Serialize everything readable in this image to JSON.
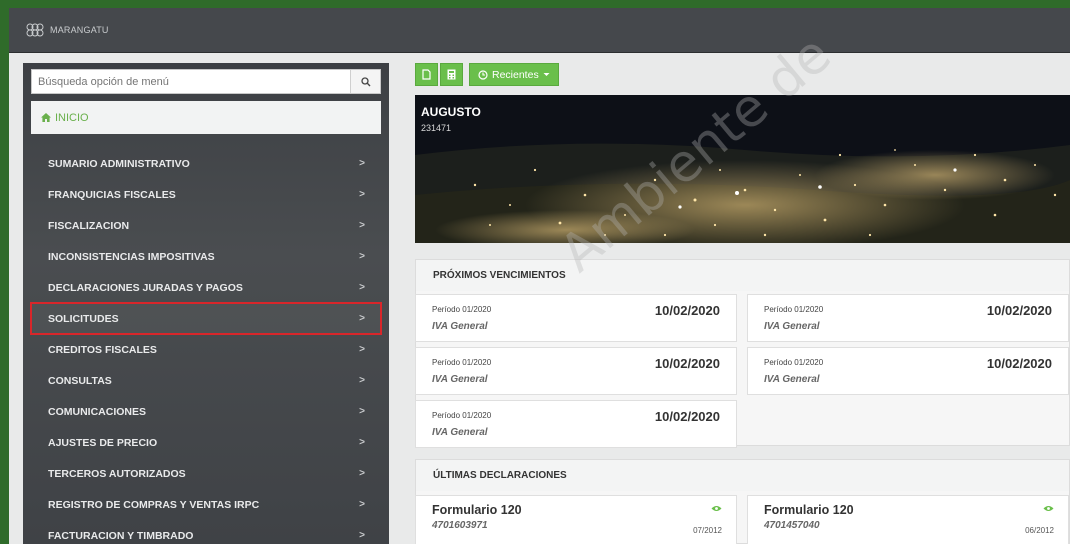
{
  "app": {
    "brand": "MARANGATU"
  },
  "sidebar": {
    "search_placeholder": "Búsqueda opción de menú",
    "inicio": "INICIO",
    "items": [
      {
        "label": "SUMARIO ADMINISTRATIVO"
      },
      {
        "label": "FRANQUICIAS FISCALES"
      },
      {
        "label": "FISCALIZACION"
      },
      {
        "label": "INCONSISTENCIAS IMPOSITIVAS"
      },
      {
        "label": "DECLARACIONES JURADAS Y PAGOS"
      },
      {
        "label": "SOLICITUDES"
      },
      {
        "label": "CREDITOS FISCALES"
      },
      {
        "label": "CONSULTAS"
      },
      {
        "label": "COMUNICACIONES"
      },
      {
        "label": "AJUSTES DE PRECIO"
      },
      {
        "label": "TERCEROS AUTORIZADOS"
      },
      {
        "label": "REGISTRO DE COMPRAS Y VENTAS IRPC"
      },
      {
        "label": "FACTURACION Y TIMBRADO"
      }
    ],
    "chevron": ">",
    "selected_label": "SOLICITUDES",
    "highlight_color": "#d9262a"
  },
  "toolbar": {
    "recientes": "Recientes"
  },
  "hero": {
    "name": "AUGUSTO",
    "number": "231471"
  },
  "vencimientos": {
    "title": "PRÓXIMOS VENCIMIENTOS",
    "items": [
      {
        "period": "Período 01/2020",
        "date": "10/02/2020",
        "tax": "IVA General"
      },
      {
        "period": "Período 01/2020",
        "date": "10/02/2020",
        "tax": "IVA General"
      },
      {
        "period": "Período 01/2020",
        "date": "10/02/2020",
        "tax": "IVA General"
      },
      {
        "period": "Período 01/2020",
        "date": "10/02/2020",
        "tax": "IVA General"
      },
      {
        "period": "Período 01/2020",
        "date": "10/02/2020",
        "tax": "IVA General"
      }
    ]
  },
  "declaraciones": {
    "title": "ÚLTIMAS DECLARACIONES",
    "items": [
      {
        "form": "Formulario 120",
        "code": "4701603971",
        "period": "07/2012"
      },
      {
        "form": "Formulario 120",
        "code": "4701457040",
        "period": "06/2012"
      }
    ]
  },
  "watermark": "Ambiente de",
  "colors": {
    "accent_green": "#6abf4b",
    "sidebar_bg": "#45484c"
  }
}
